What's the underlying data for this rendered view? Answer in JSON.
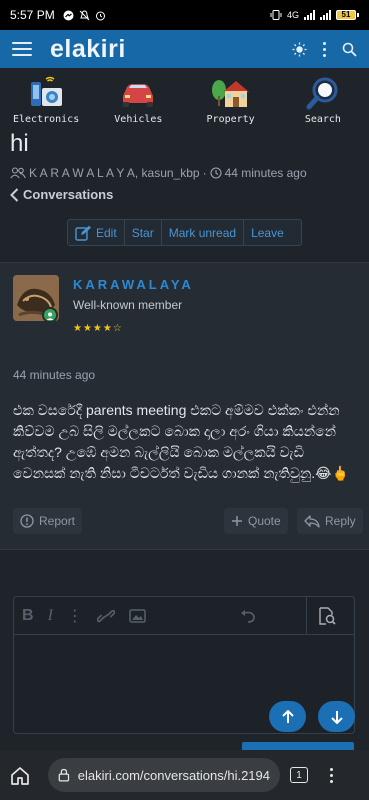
{
  "status": {
    "time": "5:57 PM",
    "battery": "51",
    "icons": [
      "messenger-icon",
      "mute-icon",
      "alarm-icon",
      "vibrate-icon",
      "network-4g-icon",
      "signal-icon",
      "battery-icon"
    ]
  },
  "header": {
    "logo": "elakiri"
  },
  "categories": [
    {
      "label": "Electronics",
      "icon": "electronics-icon"
    },
    {
      "label": "Vehicles",
      "icon": "car-icon"
    },
    {
      "label": "Property",
      "icon": "house-icon"
    },
    {
      "label": "Search",
      "icon": "magnifier-icon"
    }
  ],
  "thread": {
    "title": "hi",
    "participants": "K A R A W A L A Y A, kasun_kbp",
    "time": "44 minutes ago",
    "back_label": "Conversations"
  },
  "actions": {
    "edit": "Edit",
    "star": "Star",
    "mark_unread": "Mark unread",
    "leave": "Leave"
  },
  "message": {
    "username": "KARAWALAYA",
    "user_title": "Well-known member",
    "stars": "★★★★☆",
    "time": "44 minutes ago",
    "body": "එක වසරේදී parents meeting එකට අම්මව එක්කං එන්න කිව්වම උබ සිලි මල්ලකට බොක දාලා අරං ගියා කියන්නේ ඇත්තද? උඹේ අමන බැල්ලියි බොක මල්ලකයි වැඩි වෙනසක් නැති නිසා ටීචර්ටත් වැඩිය ගානක් නැතිවුනු.😂🖕",
    "report": "Report",
    "quote": "Quote",
    "reply": "Reply"
  },
  "editor": {
    "tools": [
      "B",
      "I",
      "⋮"
    ]
  },
  "browser": {
    "url": "elakiri.com/conversations/hi.2194",
    "tabs": "1"
  },
  "colors": {
    "brand": "#1668a6",
    "accent": "#2a8ad6",
    "online": "#3aa35a"
  }
}
